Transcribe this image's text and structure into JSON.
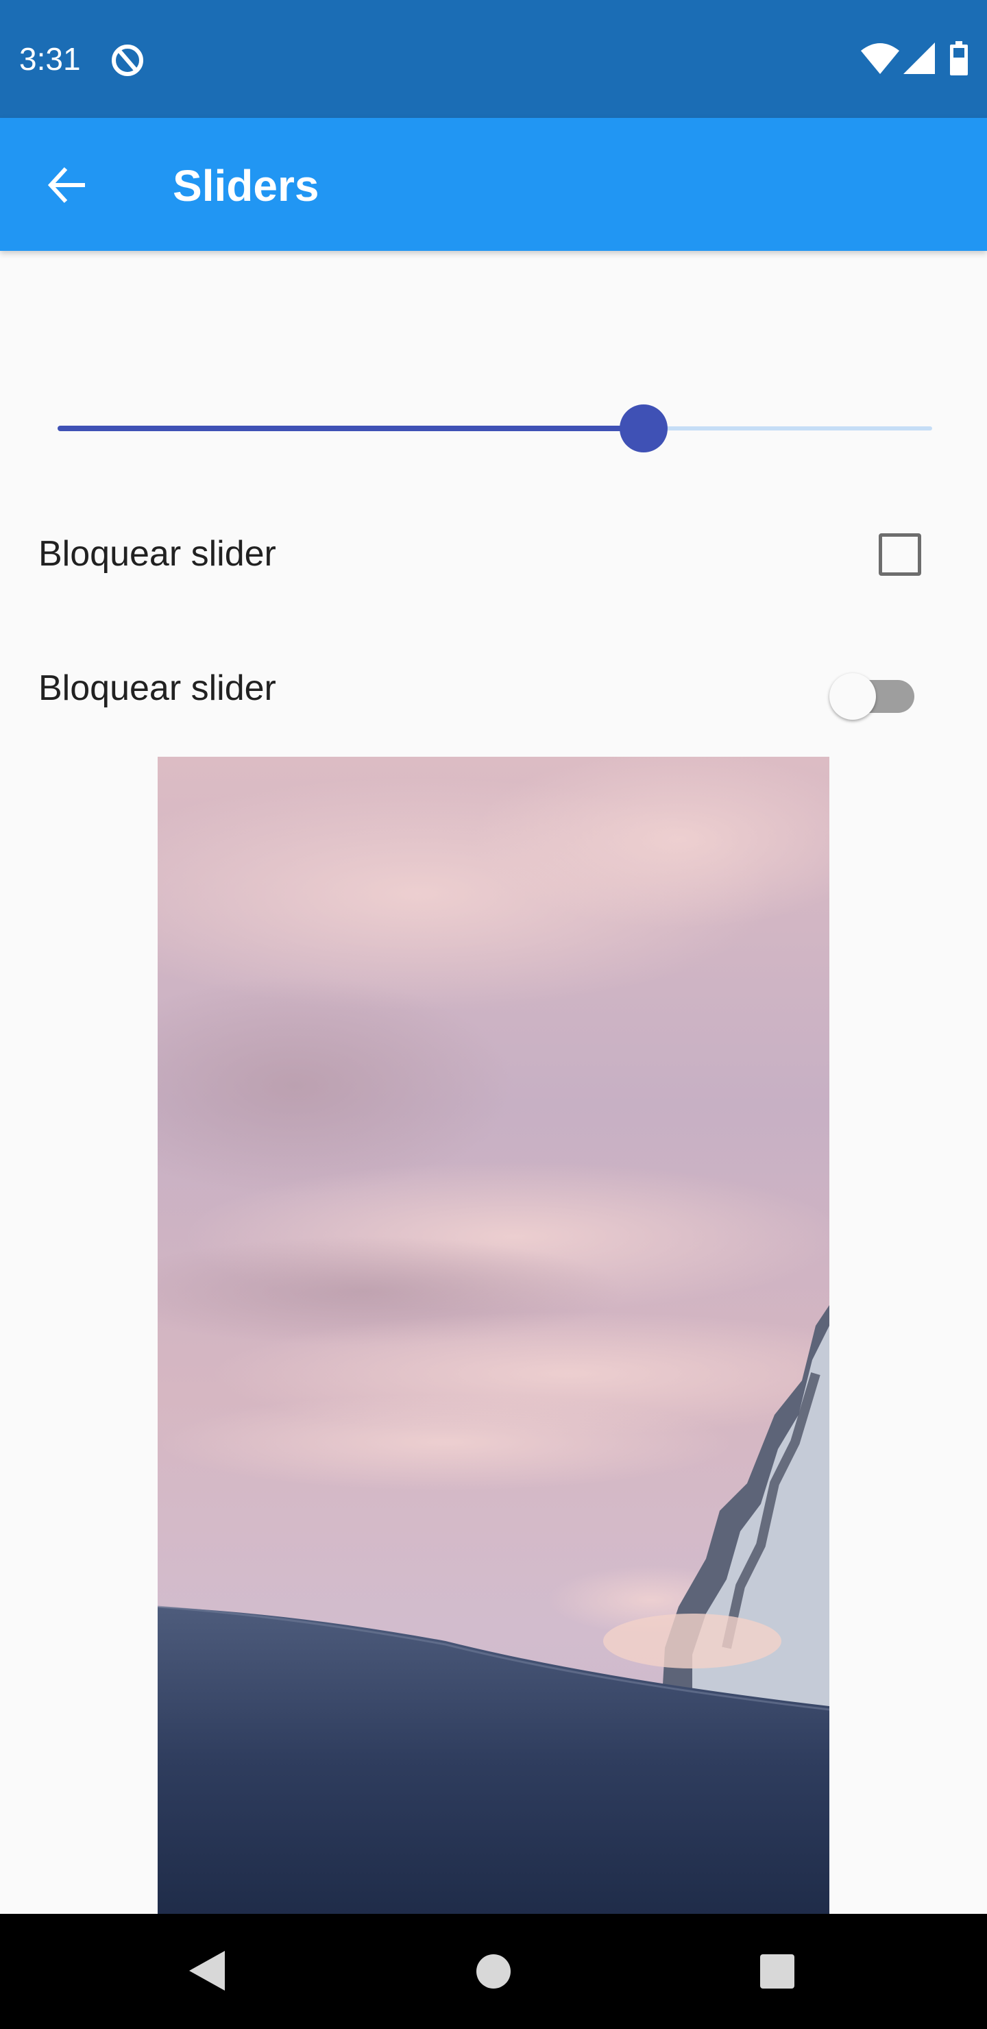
{
  "status_bar": {
    "time": "3:31",
    "icons": [
      "cast-status-icon",
      "wifi-icon",
      "cell-signal-icon",
      "battery-icon"
    ],
    "background": "#1b6db5"
  },
  "app_bar": {
    "title": "Sliders",
    "back_icon": "arrow-back-icon",
    "background": "#2196f3"
  },
  "slider": {
    "value_fraction": 0.67,
    "active_color": "#3f51b5",
    "inactive_color": "#c5ddf6"
  },
  "checkbox_row": {
    "label": "Bloquear slider",
    "checked": false
  },
  "switch_row": {
    "label": "Bloquear slider",
    "on": false
  },
  "image": {
    "subject": "snowy-mountain-at-dusk-photo"
  },
  "nav_bar": {
    "buttons": [
      "nav-back-icon",
      "nav-home-icon",
      "nav-recents-icon"
    ]
  }
}
